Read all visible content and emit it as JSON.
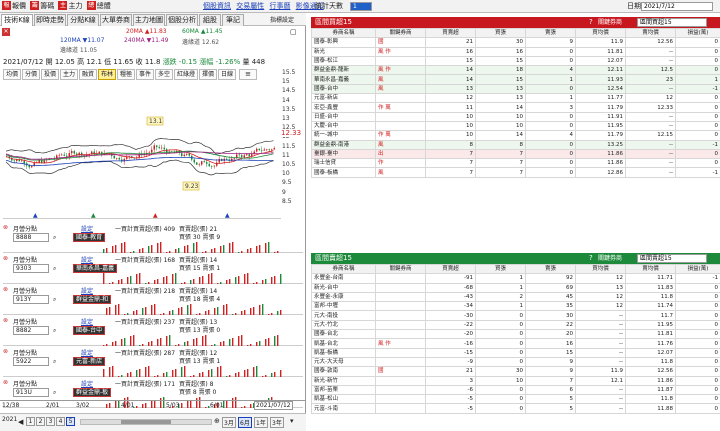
{
  "topbar": {
    "left": [
      {
        "t": "報價",
        "box": true
      },
      {
        "t": "籌碼",
        "box": true
      },
      {
        "t": "主力",
        "box": true
      },
      {
        "t": "總體",
        "box": true
      }
    ],
    "links": [
      "個股資訊",
      "交易屬性",
      "行事曆",
      "影像通知"
    ],
    "stat_label": "統計天數",
    "stat_value": "1",
    "date_label": "日期",
    "date_value": "2021/7/12"
  },
  "tabs": [
    "技術K線",
    "即時走勢",
    "分點K線",
    "大單券商",
    "主力地圖",
    "個股分析",
    "組股",
    "筆記"
  ],
  "chart_settings": "指標設定",
  "ma": {
    "r1": [
      "20MA ▲11.83",
      "60MA ▲11.45"
    ],
    "r2": [
      "120MA ▼11.07",
      "240MA ▼11.49",
      "邊緣道 12.62"
    ],
    "r3": "邊緣道 11.05"
  },
  "quote": {
    "date": "2021/07/12",
    "open": "開 12.05",
    "high": "高 12.1",
    "low": "低 11.65",
    "close": "收 11.8",
    "chg": "漲跌 -0.15",
    "pct": "漲幅 -1.26%",
    "vol": "量 448"
  },
  "tools": [
    "均價",
    "分價",
    "投價",
    "主力",
    "融資",
    "布林",
    "糧極",
    "事件",
    "多空",
    "紅綠燈",
    "擇價",
    "日線"
  ],
  "yaxis": [
    "15.5",
    "15",
    "14.5",
    "14",
    "13.5",
    "13",
    "12.5",
    "12",
    "11.5",
    "11",
    "10.5",
    "10",
    "9.5",
    "9",
    "8.5"
  ],
  "price_last": "12.33",
  "hi_mark": "13.1",
  "lo_mark": "9.23",
  "minis": [
    {
      "title": "月營分點",
      "code": "8888",
      "name": "國泰-教育",
      "l1": "一買計買賣超(張) 409",
      "l2": "買賣超(張) 21",
      "l3": "買張 30 賣張 9"
    },
    {
      "title": "月營分點",
      "code": "9303",
      "name": "華南永昌-嘉義",
      "l1": "一買計買賣超(張) 168",
      "l2": "買賣超(張) 14",
      "l3": "買張 15 賣張 1"
    },
    {
      "title": "月營分點",
      "code": "913Y",
      "name": "群益金鼎-和",
      "l1": "一買計買賣超(張) 218",
      "l2": "買賣超(張) 14",
      "l3": "買張 18 賣張 4"
    },
    {
      "title": "月營分點",
      "code": "8882",
      "name": "國泰-台中",
      "l1": "一買計買賣超(張) 237",
      "l2": "買賣超(張) 13",
      "l3": "買張 13 賣張 0"
    },
    {
      "title": "月營分點",
      "code": "5922",
      "name": "元富-新店",
      "l1": "一買計買賣超(張) 287",
      "l2": "買賣超(張) 12",
      "l3": "買張 13 賣張 1"
    },
    {
      "title": "月營分點",
      "code": "913U",
      "name": "群益金鼎-板",
      "l1": "一買計買賣超(張) 171",
      "l2": "買賣超(張) 8",
      "l3": "買張 8 賣張 0"
    }
  ],
  "xaxis": [
    "2/01",
    "3/02",
    "4/01",
    "5/03",
    "6/01"
  ],
  "cursor_date": "2021/07/12",
  "bottom": {
    "year": "2021",
    "corner": "12/38",
    "ranges": [
      "1",
      "2",
      "3",
      "4",
      "5",
      "3月",
      "6月",
      "1年",
      "3年"
    ]
  },
  "buy": {
    "title": "區間買超15",
    "select_label": "關鍵券商",
    "select_value": "區間買超15",
    "cols": [
      "券商名稱",
      "關鍵券商",
      "買賣超",
      "買張",
      "賣張",
      "買均價",
      "賣均價",
      "損益(萬)"
    ],
    "rows": [
      [
        "國泰-彰興",
        "國",
        "21",
        "30",
        "9",
        "11.9",
        "12.56",
        "0"
      ],
      [
        "新光",
        "風 作",
        "16",
        "16",
        "0",
        "11.81",
        "--",
        "0"
      ],
      [
        "國泰-松江",
        "",
        "15",
        "15",
        "0",
        "12.07",
        "--",
        "0"
      ],
      [
        "群益金鼎-龍新",
        "風 作",
        "14",
        "18",
        "4",
        "12.11",
        "12.5",
        "0"
      ],
      [
        "華南永昌-嘉義",
        "風",
        "14",
        "15",
        "1",
        "11.93",
        "23",
        "1"
      ],
      [
        "國泰-台中",
        "風",
        "13",
        "13",
        "0",
        "12.54",
        "--",
        "-1"
      ],
      [
        "元富-新店",
        "",
        "12",
        "13",
        "1",
        "11.77",
        "12",
        "0"
      ],
      [
        "宏亞-鑫豐",
        "作 萬",
        "11",
        "14",
        "3",
        "11.79",
        "12.33",
        "0"
      ],
      [
        "日盛-台中",
        "",
        "10",
        "10",
        "0",
        "11.91",
        "--",
        "0"
      ],
      [
        "大慶-台中",
        "",
        "10",
        "10",
        "0",
        "11.95",
        "--",
        "0"
      ],
      [
        "統一-城中",
        "作 萬",
        "10",
        "14",
        "4",
        "11.79",
        "12.15",
        "0"
      ],
      [
        "群益金鼎-南港",
        "風",
        "8",
        "8",
        "0",
        "13.25",
        "--",
        "-1"
      ],
      [
        "臺銀-臺中",
        "出",
        "7",
        "7",
        "0",
        "11.86",
        "--",
        "0"
      ],
      [
        "瑞士信貸",
        "作",
        "7",
        "7",
        "0",
        "11.86",
        "--",
        "0"
      ],
      [
        "國泰-板橋",
        "風",
        "7",
        "7",
        "0",
        "12.86",
        "--",
        "-1"
      ]
    ]
  },
  "sell": {
    "title": "區間賣超15",
    "select_label": "關鍵券商",
    "select_value": "區間賣超15",
    "cols": [
      "券商名稱",
      "關鍵券商",
      "買賣超",
      "買張",
      "賣張",
      "買均價",
      "賣均價",
      "損益(萬)"
    ],
    "rows": [
      [
        "永豐金-台南",
        "",
        "-91",
        "1",
        "92",
        "12",
        "11.71",
        "-1"
      ],
      [
        "新光-台中",
        "",
        "-68",
        "1",
        "69",
        "13",
        "11.83",
        "0"
      ],
      [
        "永豐金-永康",
        "",
        "-43",
        "2",
        "45",
        "12",
        "11.8",
        "0"
      ],
      [
        "富邦-中壢",
        "",
        "-34",
        "1",
        "35",
        "12",
        "11.74",
        "0"
      ],
      [
        "元大-南投",
        "",
        "-30",
        "0",
        "30",
        "--",
        "11.7",
        "0"
      ],
      [
        "元大-竹北",
        "",
        "-22",
        "0",
        "22",
        "--",
        "11.95",
        "0"
      ],
      [
        "國泰-台北",
        "",
        "-20",
        "0",
        "20",
        "--",
        "11.81",
        "0"
      ],
      [
        "凱基-台北",
        "風 作",
        "-16",
        "0",
        "16",
        "--",
        "11.76",
        "0"
      ],
      [
        "凱基-板橋",
        "",
        "-15",
        "0",
        "15",
        "--",
        "12.07",
        "0"
      ],
      [
        "元大-大天母",
        "",
        "-9",
        "0",
        "9",
        "--",
        "11.8",
        "0"
      ],
      [
        "國泰-敦南",
        "國",
        "21",
        "30",
        "9",
        "11.9",
        "12.56",
        "0"
      ],
      [
        "新光-新竹",
        "",
        "3",
        "10",
        "7",
        "12.1",
        "11.86",
        "0"
      ],
      [
        "富邦-苗栗",
        "",
        "-6",
        "0",
        "6",
        "--",
        "11.87",
        "0"
      ],
      [
        "凱基-松山",
        "",
        "-5",
        "0",
        "5",
        "--",
        "11.8",
        "0"
      ],
      [
        "元富-斗南",
        "",
        "-5",
        "0",
        "5",
        "--",
        "11.88",
        "0"
      ]
    ]
  }
}
